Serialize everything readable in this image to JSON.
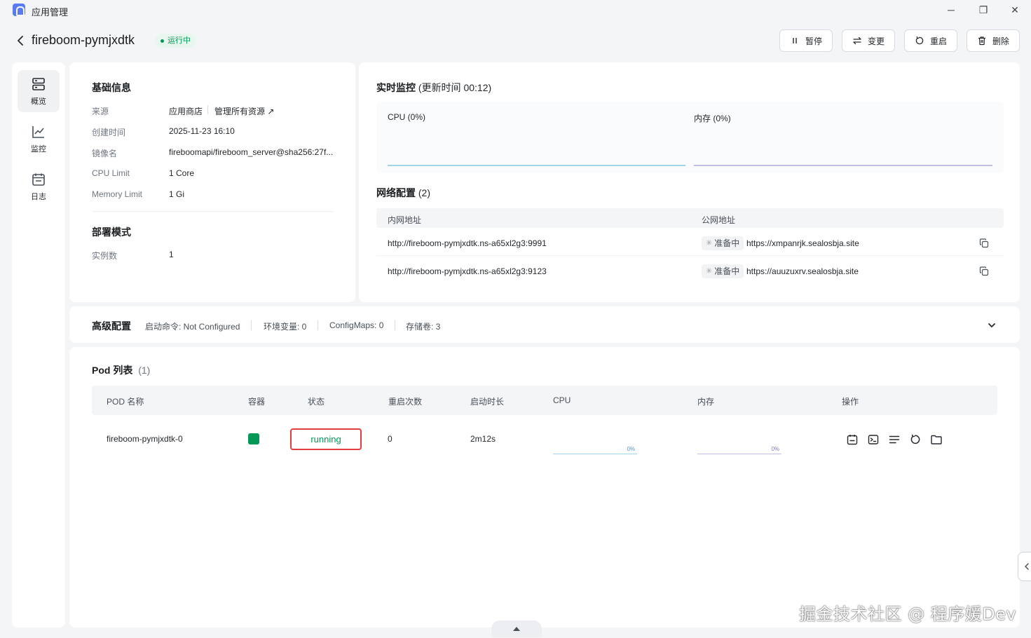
{
  "window": {
    "app_title": "应用管理",
    "controls": {
      "minimize": "─",
      "maximize": "❐",
      "close": "✕"
    }
  },
  "header": {
    "app_name": "fireboom-pymjxdtk",
    "status": "运行中",
    "buttons": {
      "pause": "暂停",
      "change": "变更",
      "restart": "重启",
      "delete": "删除"
    }
  },
  "sidebar": {
    "items": [
      {
        "label": "概览",
        "icon": "overview-icon",
        "active": true
      },
      {
        "label": "监控",
        "icon": "chart-icon",
        "active": false
      },
      {
        "label": "日志",
        "icon": "log-icon",
        "active": false
      }
    ]
  },
  "basic_info": {
    "title": "基础信息",
    "source_label": "来源",
    "source_value": "应用商店",
    "source_link": "管理所有资源",
    "created_label": "创建时间",
    "created_value": "2025-11-23 16:10",
    "image_label": "镜像名",
    "image_value": "fireboomapi/fireboom_server@sha256:27f...",
    "cpu_limit_label": "CPU Limit",
    "cpu_limit_value": "1 Core",
    "memory_limit_label": "Memory Limit",
    "memory_limit_value": "1 Gi"
  },
  "deploy_mode": {
    "title": "部署模式",
    "instances_label": "实例数",
    "instances_value": "1"
  },
  "monitor": {
    "title": "实时监控",
    "update_time": "(更新时间  00:12)",
    "cpu_label": "CPU  (0%)",
    "mem_label": "内存  (0%)",
    "cpu_color": "#9ed3e8",
    "mem_color": "#c3bde6"
  },
  "network": {
    "title": "网络配置",
    "count": "(2)",
    "headers": {
      "inner": "内网地址",
      "public": "公网地址"
    },
    "rows": [
      {
        "inner": "http://fireboom-pymjxdtk.ns-a65xl2g3:9991",
        "status": "准备中",
        "public": "https://xmpanrjk.sealosbja.site"
      },
      {
        "inner": "http://fireboom-pymjxdtk.ns-a65xl2g3:9123",
        "status": "准备中",
        "public": "https://auuzuxrv.sealosbja.site"
      }
    ]
  },
  "advanced": {
    "title": "高级配置",
    "items": {
      "startup": "启动命令: Not Configured",
      "env": "环境变量: 0",
      "configmaps": "ConfigMaps: 0",
      "storage": "存储卷: 3"
    }
  },
  "pods": {
    "title": "Pod 列表",
    "count": "(1)",
    "headers": {
      "name": "POD 名称",
      "container": "容器",
      "status": "状态",
      "restarts": "重启次数",
      "uptime": "启动时长",
      "cpu": "CPU",
      "mem": "内存",
      "actions": "操作"
    },
    "rows": [
      {
        "name": "fireboom-pymjxdtk-0",
        "container_color": "#039855",
        "status": "running",
        "restarts": "0",
        "uptime": "2m12s",
        "cpu_pct": "0%",
        "mem_pct": "0%"
      }
    ]
  },
  "watermark": "掘金技术社区 @ 程序媛Dev"
}
